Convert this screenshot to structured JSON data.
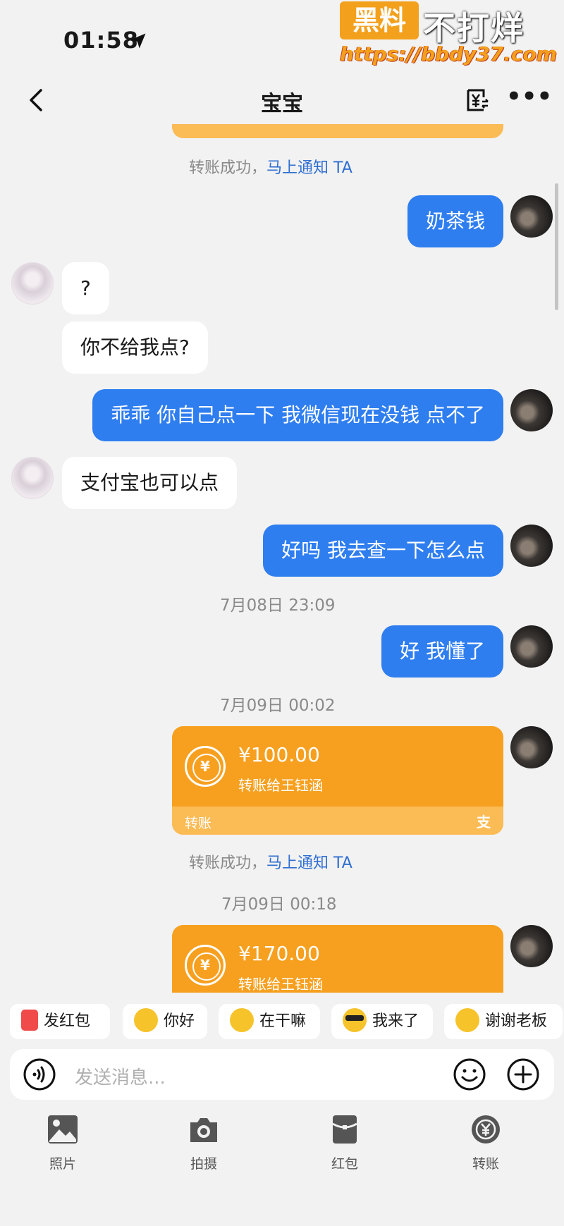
{
  "status": {
    "time": "01:58"
  },
  "watermark": {
    "badge": "黑料",
    "text": "不打烊",
    "url": "https://bbdy37.com"
  },
  "header": {
    "title": "宝宝"
  },
  "messages": {
    "sys1": {
      "text": "转账成功，",
      "link": "马上通知 TA"
    },
    "m1": "奶茶钱",
    "m2": "?",
    "m3": "你不给我点?",
    "m4": "乖乖 你自己点一下 我微信现在没钱 点不了",
    "m5": "支付宝也可以点",
    "m6": "好吗 我去查一下怎么点",
    "t1": "7月08日 23:09",
    "m7": "好 我懂了",
    "t2": "7月09日 00:02",
    "card1": {
      "amount": "¥100.00",
      "desc": "转账给王钰涵",
      "label": "转账",
      "brand": "支"
    },
    "sys2": {
      "text": "转账成功，",
      "link": "马上通知 TA"
    },
    "t3": "7月09日 00:18",
    "card2": {
      "amount": "¥170.00",
      "desc": "转账给王钰涵"
    }
  },
  "quick_replies": [
    "发红包",
    "你好",
    "在干嘛",
    "我来了",
    "谢谢老板"
  ],
  "input": {
    "placeholder": "发送消息..."
  },
  "tools": [
    "照片",
    "拍摄",
    "红包",
    "转账"
  ],
  "colors": {
    "outgoing": "#2f7ef0",
    "transfer_card": "#f7a01f",
    "link": "#2f6fd1"
  }
}
